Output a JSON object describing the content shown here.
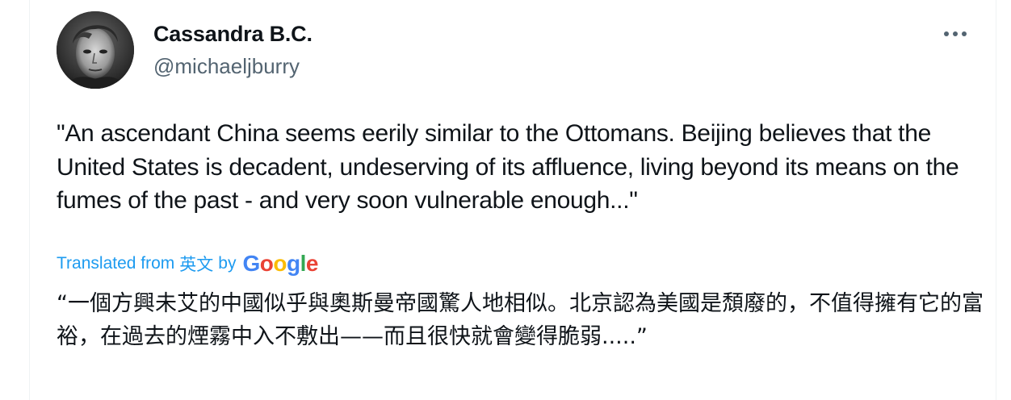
{
  "tweet": {
    "author": {
      "display_name": "Cassandra B.C.",
      "handle": "@michaeljburry"
    },
    "more_icon": "more-horizontal-icon",
    "text": "\"An ascendant China seems eerily similar to the Ottomans. Beijing believes that the United States is decadent, undeserving of its affluence, living beyond its means on the fumes of the past - and very soon vulnerable enough...\"",
    "translation": {
      "label": "Translated from",
      "language": "英文",
      "by": "by",
      "provider": {
        "letters": [
          "G",
          "o",
          "o",
          "g",
          "l",
          "e"
        ],
        "colors": [
          "#4285F4",
          "#EA4335",
          "#FBBC05",
          "#4285F4",
          "#34A853",
          "#EA4335"
        ]
      },
      "text": "“一個方興未艾的中國似乎與奧斯曼帝國驚人地相似。北京認為美國是頹廢的，不值得擁有它的富裕，在過去的煙霧中入不敷出——而且很快就會變得脆弱.....”"
    }
  },
  "colors": {
    "primary_text": "#0f1419",
    "secondary_text": "#536471",
    "link": "#1d9bf0"
  }
}
